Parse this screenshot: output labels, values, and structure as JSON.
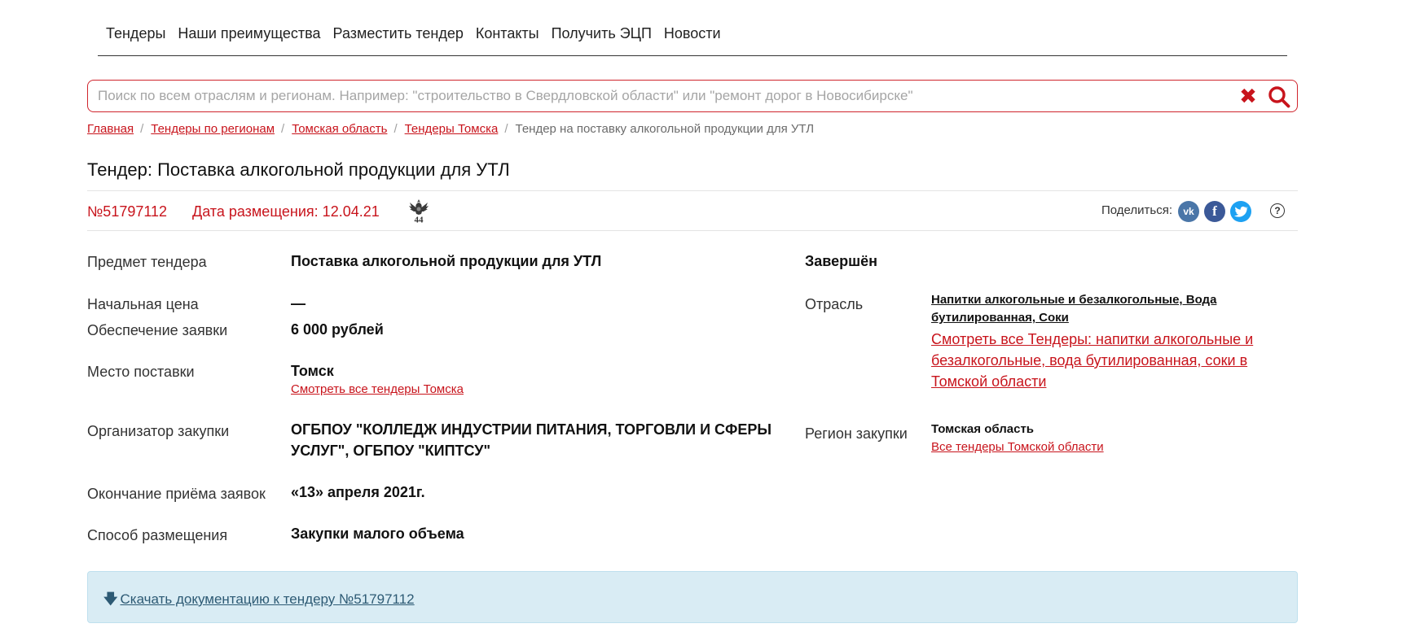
{
  "nav": {
    "items": [
      "Тендеры",
      "Наши преимущества",
      "Разместить тендер",
      "Контакты",
      "Получить ЭЦП",
      "Новости"
    ]
  },
  "search": {
    "placeholder": "Поиск по всем отраслям и регионам. Например: \"строительство в Свердловской области\" или \"ремонт дорог в Новосибирске\"",
    "clear_icon": "close-icon",
    "search_icon": "search-icon"
  },
  "breadcrumbs": {
    "items": [
      "Главная",
      "Тендеры по регионам",
      "Томская область",
      "Тендеры Томска"
    ],
    "current": "Тендер на поставку алкогольной продукции для УТЛ"
  },
  "title": "Тендер: Поставка алкогольной продукции для УТЛ",
  "meta": {
    "number": "№51797112",
    "date": "Дата размещения: 12.04.21",
    "law_badge": "44",
    "share_label": "Поделиться:",
    "social": {
      "vk": "vk",
      "fb": "f"
    },
    "help": "?"
  },
  "details": {
    "subject_label": "Предмет тендера",
    "subject_value": "Поставка алкогольной продукции для УТЛ",
    "price_label": "Начальная цена",
    "price_value": "—",
    "security_label": "Обеспечение заявки",
    "security_value": "6 000 рублей",
    "place_label": "Место поставки",
    "place_value": "Томск",
    "place_link": "Смотреть все тендеры Томска",
    "organizer_label": "Организатор закупки",
    "organizer_line1": "ОГБПОУ \"КОЛЛЕДЖ ИНДУСТРИИ ПИТАНИЯ, ТОРГОВЛИ И СФЕРЫ",
    "organizer_line2": "УСЛУГ\", ОГБПОУ \"КИПТСУ\"",
    "deadline_label": "Окончание приёма заявок",
    "deadline_value": "«13» апреля 2021г.",
    "method_label": "Способ размещения",
    "method_value": "Закупки малого объема"
  },
  "right": {
    "status": "Завершён",
    "industry_label": "Отрасль",
    "industry_line1": "Напитки алкогольные и безалкогольные, Вода",
    "industry_line2": "бутилированная, Соки",
    "industry_link_line1": "Смотреть все Тендеры: напитки алкогольные и",
    "industry_link_line2": "безалкогольные, вода бутилированная, соки в",
    "industry_link_line3": "Томской области",
    "region_label": "Регион закупки",
    "region_value": "Томская область",
    "region_link": "Все тендеры Томской области"
  },
  "download": {
    "label": "Скачать документацию к тендеру №51797112"
  }
}
